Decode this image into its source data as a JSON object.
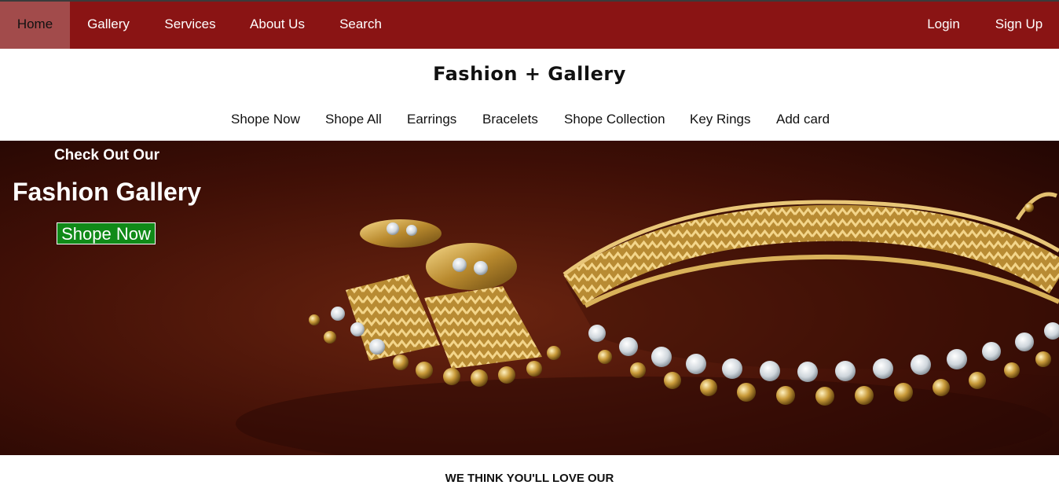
{
  "topnav": {
    "left": [
      {
        "label": "Home",
        "active": true
      },
      {
        "label": "Gallery"
      },
      {
        "label": "Services"
      },
      {
        "label": "About Us"
      },
      {
        "label": "Search"
      }
    ],
    "right": [
      {
        "label": "Login"
      },
      {
        "label": "Sign Up"
      }
    ]
  },
  "brand": {
    "title": "Fashion + Gallery"
  },
  "subnav": [
    "Shope Now",
    "Shope All",
    "Earrings",
    "Bracelets",
    "Shope Collection",
    "Key Rings",
    "Add card"
  ],
  "hero": {
    "kicker": "Check Out Our",
    "title": "Fashion Gallery",
    "cta_label": "Shope Now",
    "image": "gold-jewelry-necklace-earring-photo"
  },
  "section": {
    "heading": "WE THINK YOU'LL LOVE OUR"
  },
  "colors": {
    "topbar": "#8a1414",
    "active_tab": "#a24b4b",
    "cta": "#108a18",
    "hero_bg": "#4a1208"
  }
}
